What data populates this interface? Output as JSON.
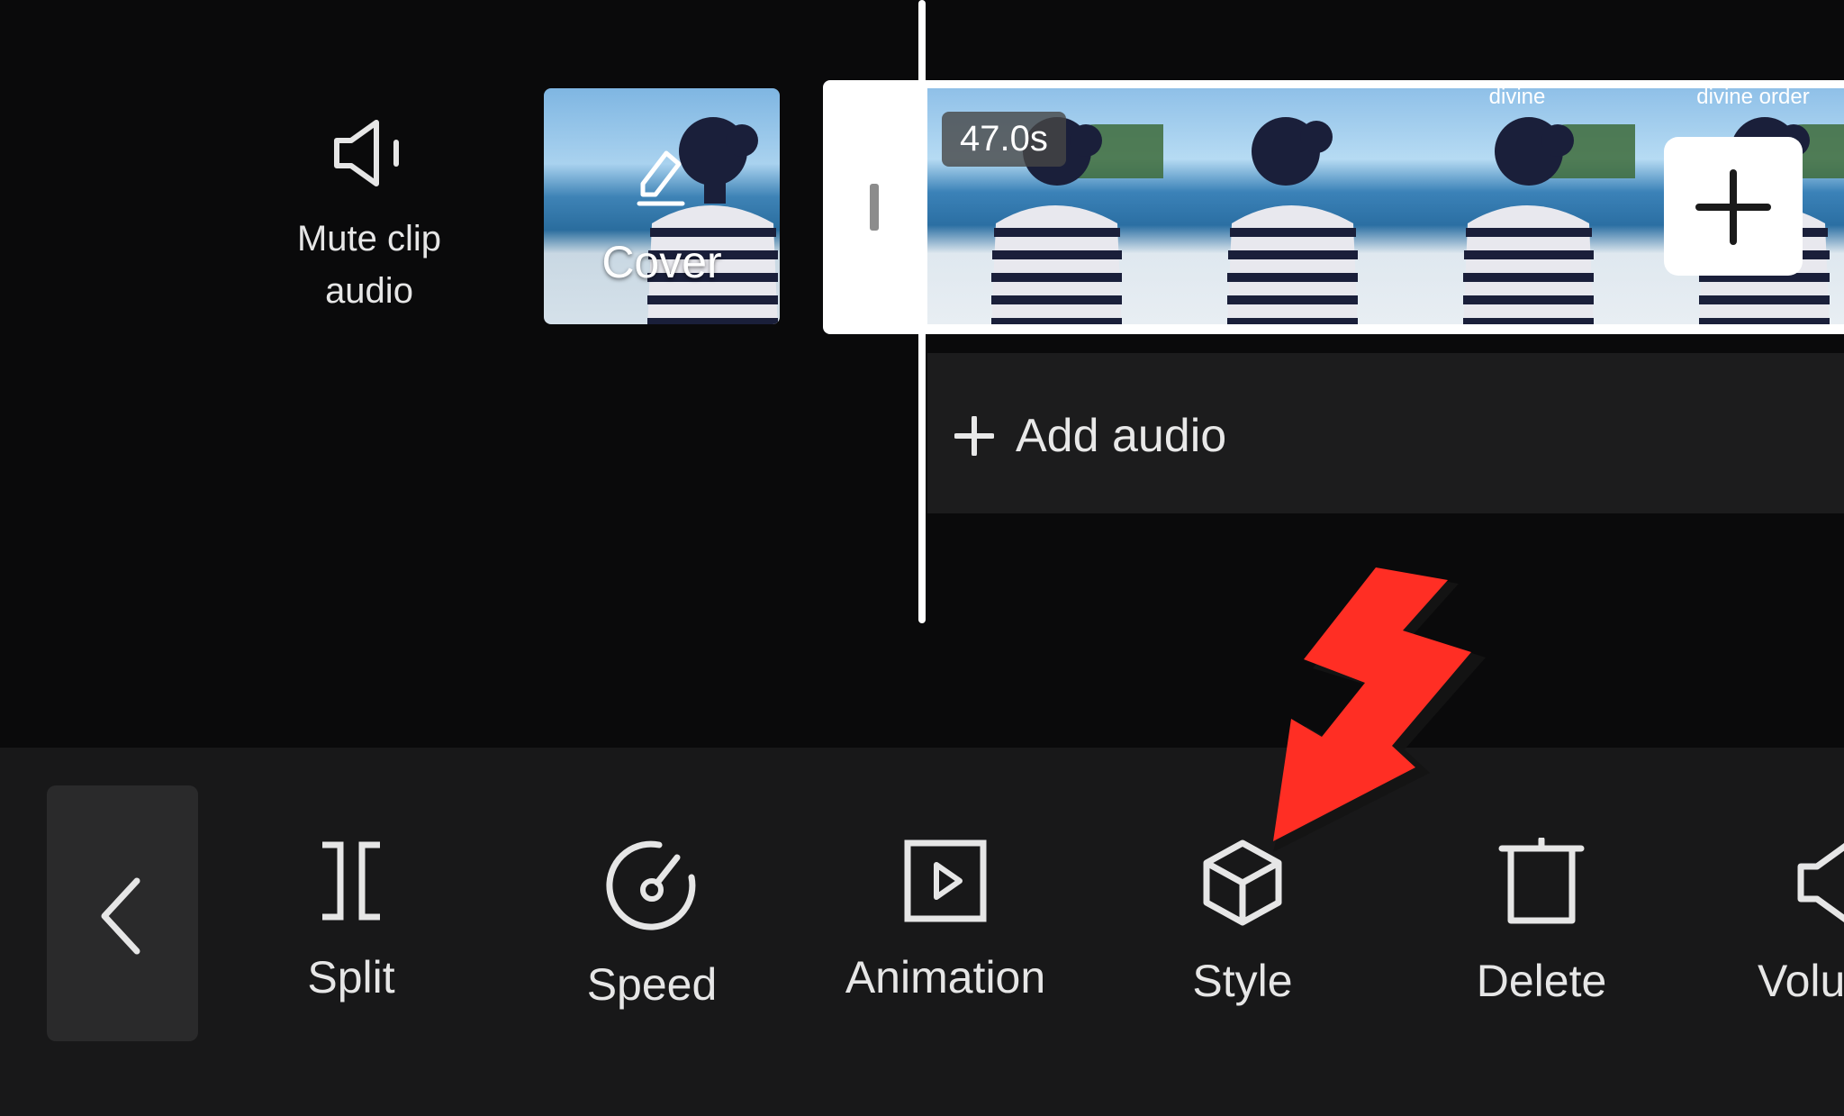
{
  "mute": {
    "label_line1": "Mute clip",
    "label_line2": "audio"
  },
  "cover": {
    "label": "Cover"
  },
  "timeline": {
    "duration": "47.0s",
    "frame_captions": [
      "",
      "",
      "divine",
      "divine order"
    ]
  },
  "audio": {
    "label": "Add audio"
  },
  "toolbar": {
    "items": [
      {
        "label": "Split"
      },
      {
        "label": "Speed"
      },
      {
        "label": "Animation"
      },
      {
        "label": "Style"
      },
      {
        "label": "Delete"
      },
      {
        "label": "Volu"
      }
    ]
  },
  "colors": {
    "accent_arrow": "#ff2e24",
    "toolbar_bg": "#181819",
    "canvas_bg": "#0a0a0b"
  }
}
